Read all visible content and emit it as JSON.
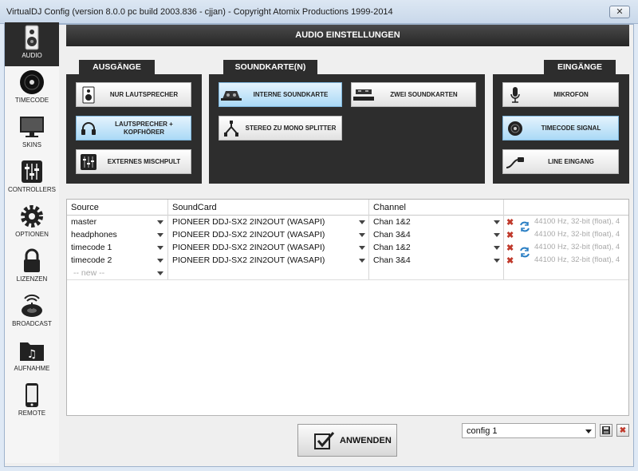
{
  "window": {
    "title": "VirtualDJ Config (version 8.0.0 pc build 2003.836 - cjjan) - Copyright Atomix Productions 1999-2014",
    "close_label": "✕"
  },
  "sidebar": {
    "items": [
      {
        "label": "AUDIO",
        "icon": "speaker-icon",
        "active": true
      },
      {
        "label": "TIMECODE",
        "icon": "vinyl-icon"
      },
      {
        "label": "SKINS",
        "icon": "monitor-icon"
      },
      {
        "label": "CONTROLLERS",
        "icon": "sliders-icon"
      },
      {
        "label": "OPTIONEN",
        "icon": "gear-icon"
      },
      {
        "label": "LIZENZEN",
        "icon": "lock-icon"
      },
      {
        "label": "BROADCAST",
        "icon": "broadcast-icon"
      },
      {
        "label": "AUFNAHME",
        "icon": "record-folder-icon"
      },
      {
        "label": "REMOTE",
        "icon": "phone-icon"
      }
    ]
  },
  "header": {
    "title": "AUDIO EINSTELLUNGEN"
  },
  "outputs": {
    "tab": "AUSGÄNGE",
    "buttons": [
      {
        "label": "NUR LAUTSPRECHER",
        "icon": "speaker-icon"
      },
      {
        "label": "LAUTSPRECHER + KOPFHÖRER",
        "icon": "headphones-icon",
        "selected": true
      },
      {
        "label": "EXTERNES MISCHPULT",
        "icon": "mixer-icon"
      }
    ]
  },
  "soundcard": {
    "tab": "SOUNDKARTE(N)",
    "buttons": [
      {
        "label": "INTERNE SOUNDKARTE",
        "icon": "controller-icon",
        "selected": true
      },
      {
        "label": "ZWEI SOUNDKARTEN",
        "icon": "two-cards-icon"
      },
      {
        "label": "STEREO ZU MONO SPLITTER",
        "icon": "splitter-cable-icon"
      }
    ]
  },
  "inputs": {
    "tab": "EINGÄNGE",
    "buttons": [
      {
        "label": "MIKROFON",
        "icon": "microphone-icon"
      },
      {
        "label": "TIMECODE SIGNAL",
        "icon": "timecode-disc-icon",
        "selected": true
      },
      {
        "label": "LINE EINGANG",
        "icon": "cable-icon"
      }
    ]
  },
  "table": {
    "headers": {
      "source": "Source",
      "soundcard": "SoundCard",
      "channel": "Channel"
    },
    "rows": [
      {
        "source": "master",
        "soundcard": "PIONEER DDJ-SX2 2IN2OUT (WASAPI)",
        "channel": "Chan 1&2",
        "info": "44100 Hz, 32-bit (float), 4"
      },
      {
        "source": "headphones",
        "soundcard": "PIONEER DDJ-SX2 2IN2OUT (WASAPI)",
        "channel": "Chan 3&4",
        "info": "44100 Hz, 32-bit (float), 4"
      },
      {
        "source": "timecode 1",
        "soundcard": "PIONEER DDJ-SX2 2IN2OUT (WASAPI)",
        "channel": "Chan 1&2",
        "info": "44100 Hz, 32-bit (float), 4"
      },
      {
        "source": "timecode 2",
        "soundcard": "PIONEER DDJ-SX2 2IN2OUT (WASAPI)",
        "channel": "Chan 3&4",
        "info": "44100 Hz, 32-bit (float), 4"
      }
    ],
    "new_row_label": "-- new --"
  },
  "footer": {
    "apply_label": "ANWENDEN",
    "config_value": "config 1"
  },
  "colors": {
    "accent_selected": "#aad9f6",
    "panel": "#2d2d2d",
    "delete": "#c0392b",
    "link": "#2a7fc4"
  }
}
